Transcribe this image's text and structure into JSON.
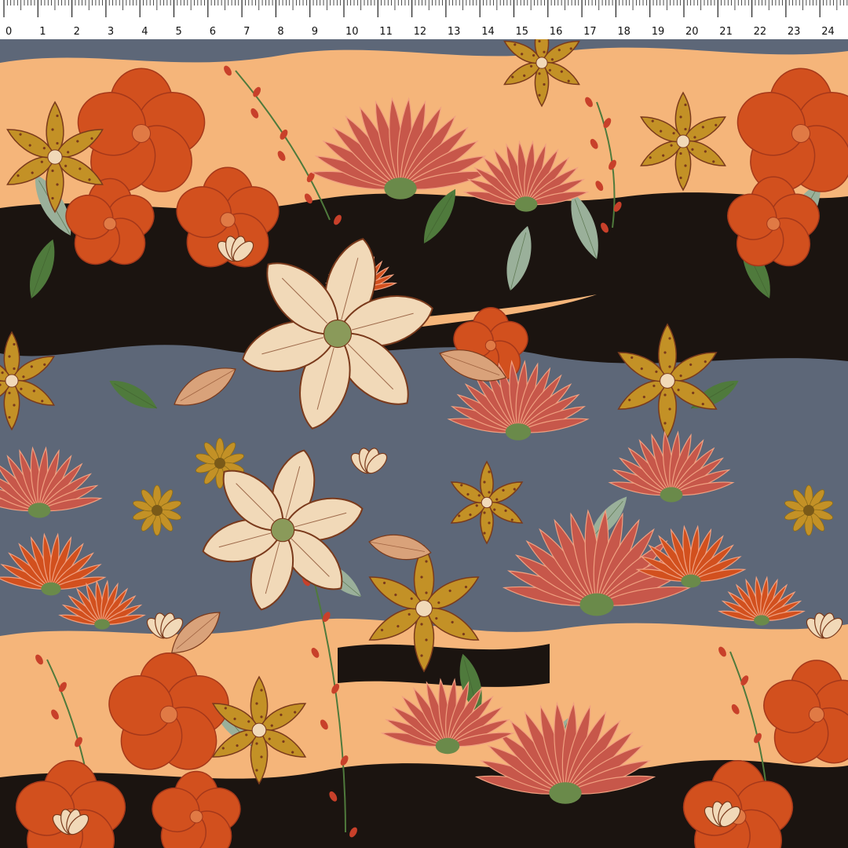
{
  "ruler": {
    "unit_count": 25,
    "labels": [
      "0",
      "1",
      "2",
      "3",
      "4",
      "5",
      "6",
      "7",
      "8",
      "9",
      "10",
      "11",
      "12",
      "13",
      "14",
      "15",
      "16",
      "17",
      "18",
      "19",
      "20",
      "21",
      "22",
      "23",
      "24",
      "2"
    ]
  },
  "pattern": {
    "background": "#5d6778",
    "colors": {
      "peach": "#f5b57a",
      "black": "#1b1410",
      "slate": "#5d6778",
      "orange": "#d2501e",
      "coral": "#c7574a",
      "mustard": "#c39126",
      "cream": "#f1d9b8",
      "sage": "#9ab09a",
      "green": "#4f7a3c",
      "brown": "#7a3a1c",
      "berry": "#c8402a"
    }
  }
}
